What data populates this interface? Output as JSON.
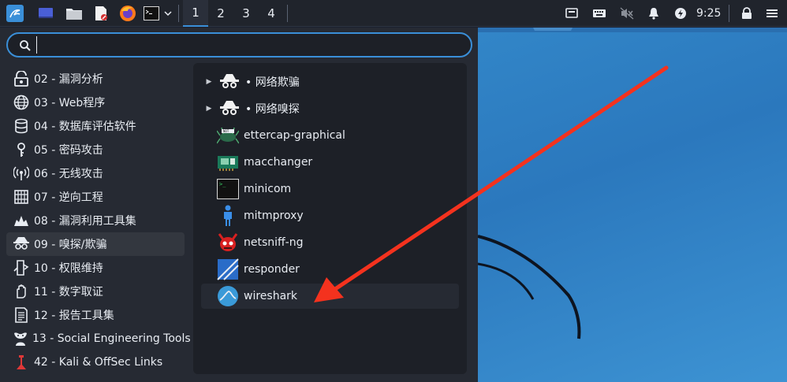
{
  "taskbar": {
    "workspaces": [
      "1",
      "2",
      "3",
      "4"
    ],
    "active_workspace": "1",
    "clock": "9:25",
    "launchers": [
      "kali-menu-icon",
      "desktop-icon",
      "file-manager-icon",
      "text-editor-icon",
      "firefox-icon",
      "terminal-icon"
    ],
    "tray": [
      "display-icon",
      "keyboard-icon",
      "mute-icon",
      "bell-icon",
      "power-icon",
      "lock-icon",
      "menu-lines-icon"
    ]
  },
  "search": {
    "value": "",
    "placeholder": ""
  },
  "categories": [
    {
      "label": "02 - 漏洞分析",
      "icon": "vulnerability-icon"
    },
    {
      "label": "03 - Web程序",
      "icon": "globe-icon"
    },
    {
      "label": "04 - 数据库评估软件",
      "icon": "database-icon"
    },
    {
      "label": "05 - 密码攻击",
      "icon": "key-icon"
    },
    {
      "label": "06 - 无线攻击",
      "icon": "wireless-icon"
    },
    {
      "label": "07 - 逆向工程",
      "icon": "reverse-icon"
    },
    {
      "label": "08 - 漏洞利用工具集",
      "icon": "exploit-icon"
    },
    {
      "label": "09 - 嗅探/欺骗",
      "icon": "sniffer-icon",
      "selected": true
    },
    {
      "label": "10 - 权限维持",
      "icon": "persistence-icon"
    },
    {
      "label": "11 - 数字取证",
      "icon": "forensics-icon"
    },
    {
      "label": "12 - 报告工具集",
      "icon": "report-icon"
    },
    {
      "label": "13 - Social Engineering Tools",
      "icon": "social-engineering-icon"
    },
    {
      "label": "42 - Kali & OffSec Links",
      "icon": "kali-links-icon"
    }
  ],
  "apps": [
    {
      "label": "• 网络欺骗",
      "icon": "spy-icon",
      "submenu": true
    },
    {
      "label": "• 网络嗅探",
      "icon": "spy-icon",
      "submenu": true
    },
    {
      "label": "ettercap-graphical",
      "icon": "ettercap-icon"
    },
    {
      "label": "macchanger",
      "icon": "macchanger-icon"
    },
    {
      "label": "minicom",
      "icon": "terminal-icon"
    },
    {
      "label": "mitmproxy",
      "icon": "mitmproxy-icon"
    },
    {
      "label": "netsniff-ng",
      "icon": "netsniff-icon"
    },
    {
      "label": "responder",
      "icon": "responder-icon"
    },
    {
      "label": "wireshark",
      "icon": "wireshark-icon",
      "highlight": true
    }
  ],
  "colors": {
    "accent": "#3a8fd8",
    "arrow": "#f4321e",
    "desktop": "#3286c8"
  }
}
